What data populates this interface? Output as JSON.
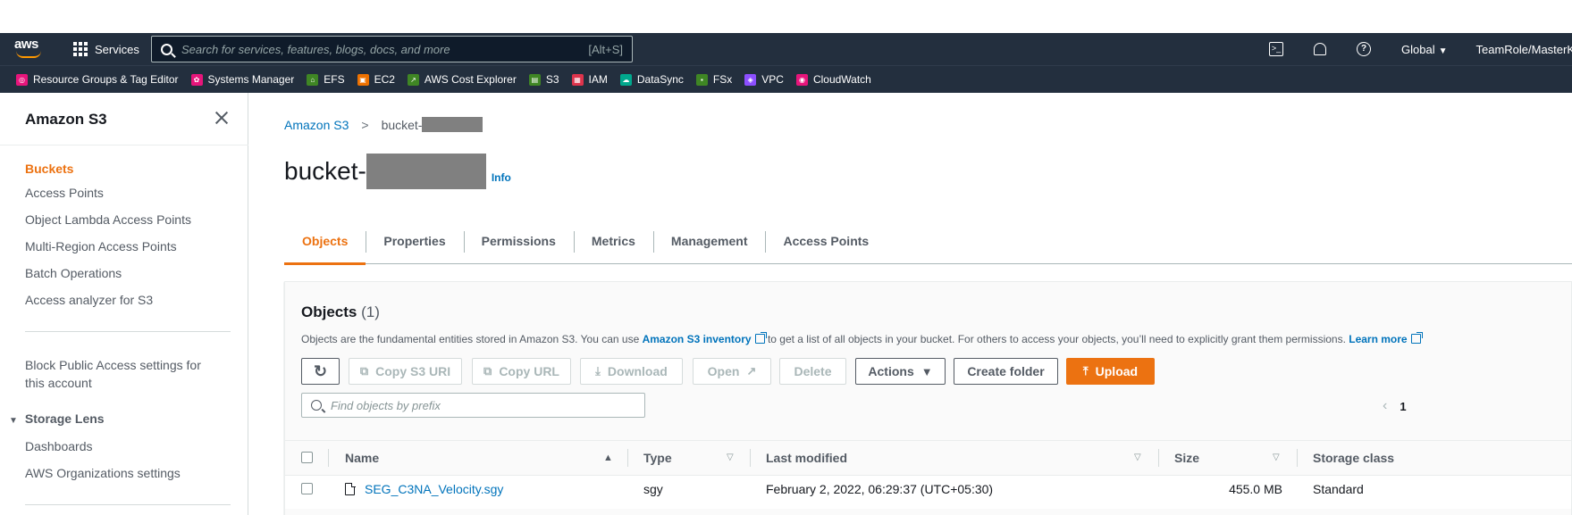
{
  "topnav": {
    "logo_text": "aws",
    "services_label": "Services",
    "search_placeholder": "Search for services, features, blogs, docs, and more",
    "search_shortcut": "[Alt+S]",
    "region": "Global",
    "account": "TeamRole/MasterK"
  },
  "favorites": [
    {
      "label": "Resource Groups & Tag Editor",
      "color": "#e7157b"
    },
    {
      "label": "Systems Manager",
      "color": "#e7157b"
    },
    {
      "label": "EFS",
      "color": "#3f8624"
    },
    {
      "label": "EC2",
      "color": "#ed7100"
    },
    {
      "label": "AWS Cost Explorer",
      "color": "#3f8624"
    },
    {
      "label": "S3",
      "color": "#3f8624"
    },
    {
      "label": "IAM",
      "color": "#dd344c"
    },
    {
      "label": "DataSync",
      "color": "#01a88d"
    },
    {
      "label": "FSx",
      "color": "#3f8624"
    },
    {
      "label": "VPC",
      "color": "#8c4fff"
    },
    {
      "label": "CloudWatch",
      "color": "#e7157b"
    }
  ],
  "sidebar": {
    "title": "Amazon S3",
    "items": [
      "Buckets",
      "Access Points",
      "Object Lambda Access Points",
      "Multi-Region Access Points",
      "Batch Operations",
      "Access analyzer for S3"
    ],
    "block_public_line1": "Block Public Access settings for",
    "block_public_line2": "this account",
    "storage_lens": "Storage Lens",
    "lens_items": [
      "Dashboards",
      "AWS Organizations settings"
    ]
  },
  "breadcrumb": {
    "root": "Amazon S3",
    "current": "bucket-"
  },
  "page": {
    "title": "bucket-",
    "info": "Info"
  },
  "tabs": [
    "Objects",
    "Properties",
    "Permissions",
    "Metrics",
    "Management",
    "Access Points"
  ],
  "objects_panel": {
    "title": "Objects",
    "count": "(1)",
    "desc_part1": "Objects are the fundamental entities stored in Amazon S3. You can use ",
    "desc_link1": "Amazon S3 inventory",
    "desc_part2": " to get a list of all objects in your bucket. For others to access your objects, you’ll need to explicitly grant them permissions. ",
    "desc_link2": "Learn more",
    "buttons": {
      "copy_uri": "Copy S3 URI",
      "copy_url": "Copy URL",
      "download": "Download",
      "open": "Open",
      "delete": "Delete",
      "actions": "Actions",
      "create_folder": "Create folder",
      "upload": "Upload"
    },
    "find_placeholder": "Find objects by prefix",
    "page_number": "1",
    "columns": [
      "Name",
      "Type",
      "Last modified",
      "Size",
      "Storage class"
    ],
    "rows": [
      {
        "name": "SEG_C3NA_Velocity.sgy",
        "type": "sgy",
        "modified": "February 2, 2022, 06:29:37 (UTC+05:30)",
        "size": "455.0 MB",
        "storage": "Standard"
      }
    ]
  },
  "colors": {
    "nav_bg": "#232f3e",
    "accent": "#ec7211",
    "link": "#0073bb"
  }
}
